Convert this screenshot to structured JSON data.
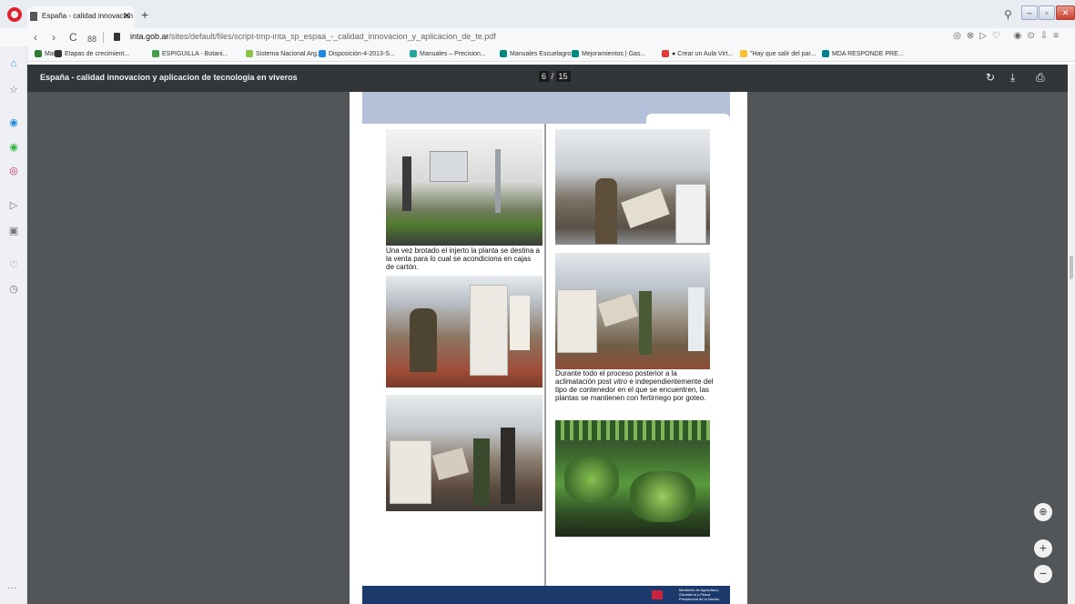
{
  "browser": {
    "tab_title": "España - calidad innovacion",
    "tab_close": "✕",
    "new_tab": "+",
    "url_domain": "inta.gob.ar",
    "url_path": "/sites/default/files/script-tmp-inta_sp_espaa_-_calidad_innovacion_y_aplicacion_de_te.pdf",
    "nav_back": "‹",
    "nav_forward": "›",
    "nav_reload": "C",
    "nav_tabs": "88",
    "right_icons": "◎⊗▷♡ ◉⊙⇩≡",
    "search_icon": "⚲",
    "win_min": "–",
    "win_max": "▫",
    "win_close": "✕"
  },
  "bookmarks": [
    {
      "label": "Maíz",
      "color": "#2e7d32"
    },
    {
      "label": "Etapas de crecimient...",
      "color": "#333333"
    },
    {
      "label": "ESPIGUILLA - Botani...",
      "color": "#43a047"
    },
    {
      "label": "Sistema Nacional Arg...",
      "color": "#8bc34a"
    },
    {
      "label": "Disposición-4-2013-S...",
      "color": "#1e88e5"
    },
    {
      "label": "Manuales – Precision...",
      "color": "#26a69a"
    },
    {
      "label": "Manuales Escuelagro...",
      "color": "#00897b"
    },
    {
      "label": "Mejoramientos | Gas...",
      "color": "#00897b"
    },
    {
      "label": "● Crear un Aula Virt...",
      "color": "#e53935"
    },
    {
      "label": "\"Hay que salir del par...",
      "color": "#fbc02d"
    },
    {
      "label": "MDA RESPONDE PRE...",
      "color": "#00838f"
    }
  ],
  "sidebar": {
    "icons": [
      {
        "name": "home-icon",
        "glyph": "⌂",
        "color": "#1e88e5"
      },
      {
        "name": "star-icon",
        "glyph": "☆",
        "color": "#777777"
      },
      {
        "name": "messenger-icon",
        "glyph": "◉",
        "color": "#1e88e5"
      },
      {
        "name": "whatsapp-icon",
        "glyph": "◉",
        "color": "#2db742"
      },
      {
        "name": "instagram-icon",
        "glyph": "◎",
        "color": "#d6246e"
      },
      {
        "name": "send-icon",
        "glyph": "▷",
        "color": "#777777"
      },
      {
        "name": "wallet-icon",
        "glyph": "▣",
        "color": "#777777"
      },
      {
        "name": "heart-icon",
        "glyph": "♡",
        "color": "#777777"
      },
      {
        "name": "clock-icon",
        "glyph": "◷",
        "color": "#777777"
      }
    ],
    "more": "···"
  },
  "pdf": {
    "title": "España - calidad innovacion y aplicacion de tecnologia en viveros",
    "page_current": "6",
    "page_total": "15",
    "rotate_icon": "↻",
    "download_icon": "⤓",
    "print_icon": "⎙",
    "fit_icon": "⊕",
    "zoom_in": "+",
    "zoom_out": "−"
  },
  "page_content": {
    "caption_1": "Una vez brotado el injerto la planta se destina a la venta para lo cual se acondiciona en cajas de cartón.",
    "caption_2_part1": "Durante todo el proceso posterior a la aclimatación post ",
    "caption_2_italic": "vitro",
    "caption_2_part2": " e independientemente del tipo de contenedor en el que se encuentren, las plantas se mantienen con fertirriego por goteo.",
    "footer_org": "Ministerio de Agricultura, Ganadería y Pesca Presidencia de la Nación"
  }
}
